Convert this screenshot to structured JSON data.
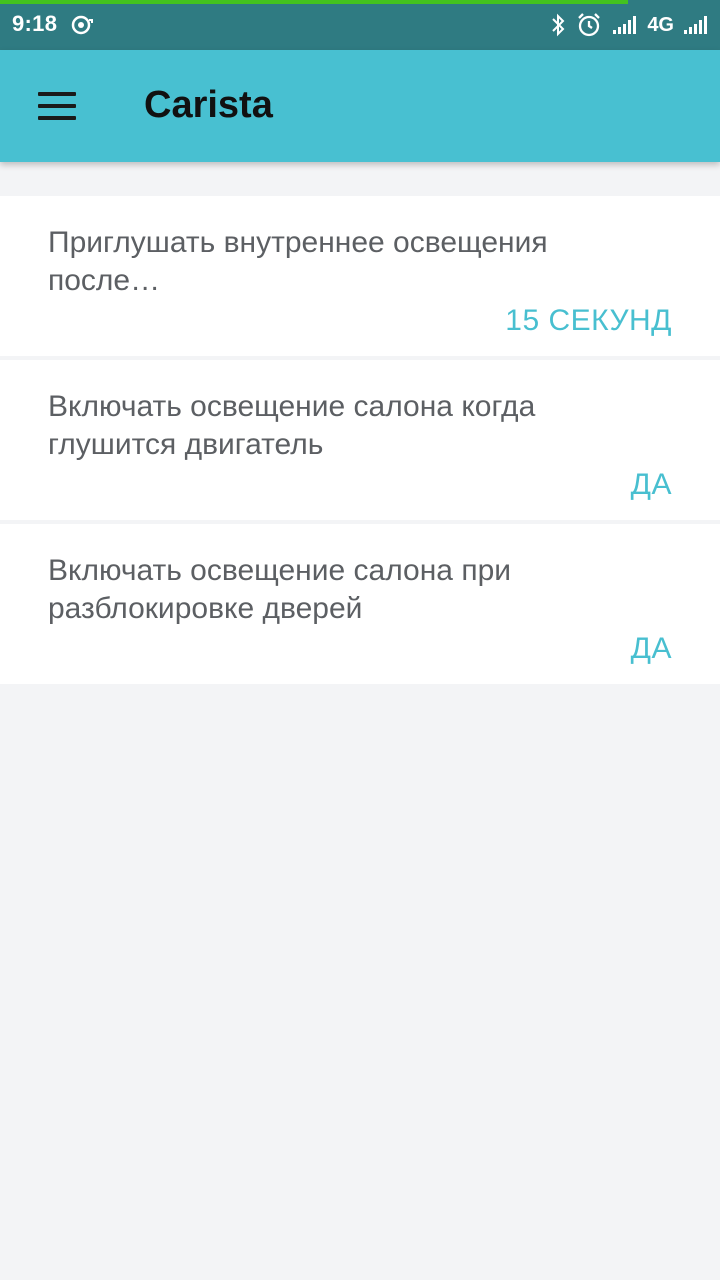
{
  "status_bar": {
    "time": "9:18",
    "network": "4G",
    "icons": [
      "sync-icon",
      "bluetooth-icon",
      "alarm-icon",
      "signal-icon",
      "network-4g-icon",
      "signal-icon"
    ],
    "colors": {
      "background": "#2f7b82",
      "progress": "#43c21f"
    }
  },
  "app_bar": {
    "title": "Carista",
    "menu_icon": "hamburger-menu-icon",
    "color": "#48c0d1"
  },
  "settings": [
    {
      "title": "Приглушать внутреннее освещения после…",
      "value": "15 СЕКУНД"
    },
    {
      "title": "Включать освещение салона когда глушится двигатель",
      "value": "ДА"
    },
    {
      "title": "Включать освещение салона при разблокировке дверей",
      "value": "ДА"
    }
  ],
  "accent_color": "#48bfd0"
}
